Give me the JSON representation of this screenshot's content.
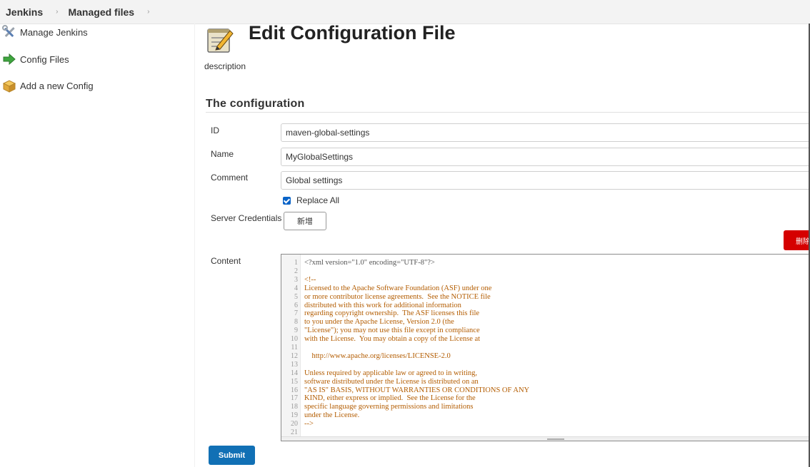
{
  "breadcrumb": {
    "items": [
      {
        "label": "Jenkins"
      },
      {
        "label": "Managed files"
      }
    ],
    "separator": "›"
  },
  "sidebar": {
    "items": [
      {
        "label": "Manage Jenkins",
        "icon": "wrench-screwdriver-icon"
      },
      {
        "label": "Config Files",
        "icon": "green-arrow-icon"
      },
      {
        "label": "Add a new Config",
        "icon": "package-icon"
      }
    ]
  },
  "main": {
    "title": "Edit Configuration File",
    "title_icon": "notepad-pencil-icon",
    "description": "description",
    "section_title": "The configuration",
    "fields": {
      "id": {
        "label": "ID",
        "value": "maven-global-settings"
      },
      "name": {
        "label": "Name",
        "value": "MyGlobalSettings"
      },
      "comment": {
        "label": "Comment",
        "value": "Global settings"
      }
    },
    "replace_all": {
      "label": "Replace All",
      "checked": true
    },
    "server_credentials": {
      "label": "Server Credentials",
      "add_button": "新增",
      "delete_button": "删除"
    },
    "content": {
      "label": "Content",
      "lines": [
        "<?xml version=\"1.0\" encoding=\"UTF-8\"?>",
        "",
        "<!--",
        "Licensed to the Apache Software Foundation (ASF) under one",
        "or more contributor license agreements.  See the NOTICE file",
        "distributed with this work for additional information",
        "regarding copyright ownership.  The ASF licenses this file",
        "to you under the Apache License, Version 2.0 (the",
        "\"License\"); you may not use this file except in compliance",
        "with the License.  You may obtain a copy of the License at",
        "",
        "    http://www.apache.org/licenses/LICENSE-2.0",
        "",
        "Unless required by applicable law or agreed to in writing,",
        "software distributed under the License is distributed on an",
        "\"AS IS\" BASIS, WITHOUT WARRANTIES OR CONDITIONS OF ANY",
        "KIND, either express or implied.  See the License for the",
        "specific language governing permissions and limitations",
        "under the License.",
        "-->",
        ""
      ],
      "line_numbers": [
        "1",
        "2",
        "3",
        "4",
        "5",
        "6",
        "7",
        "8",
        "9",
        "10",
        "11",
        "12",
        "13",
        "14",
        "15",
        "16",
        "17",
        "18",
        "19",
        "20",
        "21"
      ]
    },
    "submit_label": "Submit"
  },
  "colors": {
    "submit": "#1170b5",
    "delete": "#d50000",
    "checkbox": "#0a64c8",
    "code_comment": "#b35c00"
  }
}
